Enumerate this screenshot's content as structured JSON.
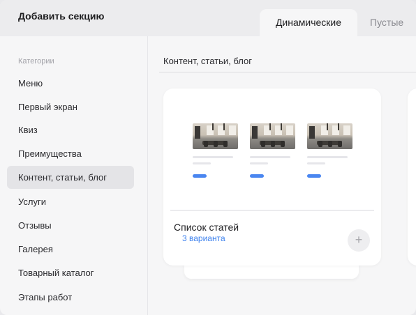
{
  "header": {
    "title": "Добавить секцию",
    "tabs": [
      {
        "label": "Динамические",
        "active": true
      },
      {
        "label": "Пустые",
        "active": false
      }
    ]
  },
  "sidebar": {
    "label": "Категории",
    "items": [
      {
        "label": "Меню"
      },
      {
        "label": "Первый экран"
      },
      {
        "label": "Квиз"
      },
      {
        "label": "Преимущества"
      },
      {
        "label": "Контент, статьи, блог",
        "active": true
      },
      {
        "label": "Услуги"
      },
      {
        "label": "Отзывы"
      },
      {
        "label": "Галерея"
      },
      {
        "label": "Товарный каталог"
      },
      {
        "label": "Этапы работ"
      }
    ]
  },
  "main": {
    "section_title": "Контент, статьи, блог",
    "cards": [
      {
        "name": "Список статей",
        "variants": "3 варианта",
        "add_icon": "+"
      }
    ]
  },
  "colors": {
    "accent": "#3e82ee",
    "header_bg": "#ececee",
    "panel_bg": "#f6f6f7",
    "active_item_bg": "#e4e4e7"
  }
}
